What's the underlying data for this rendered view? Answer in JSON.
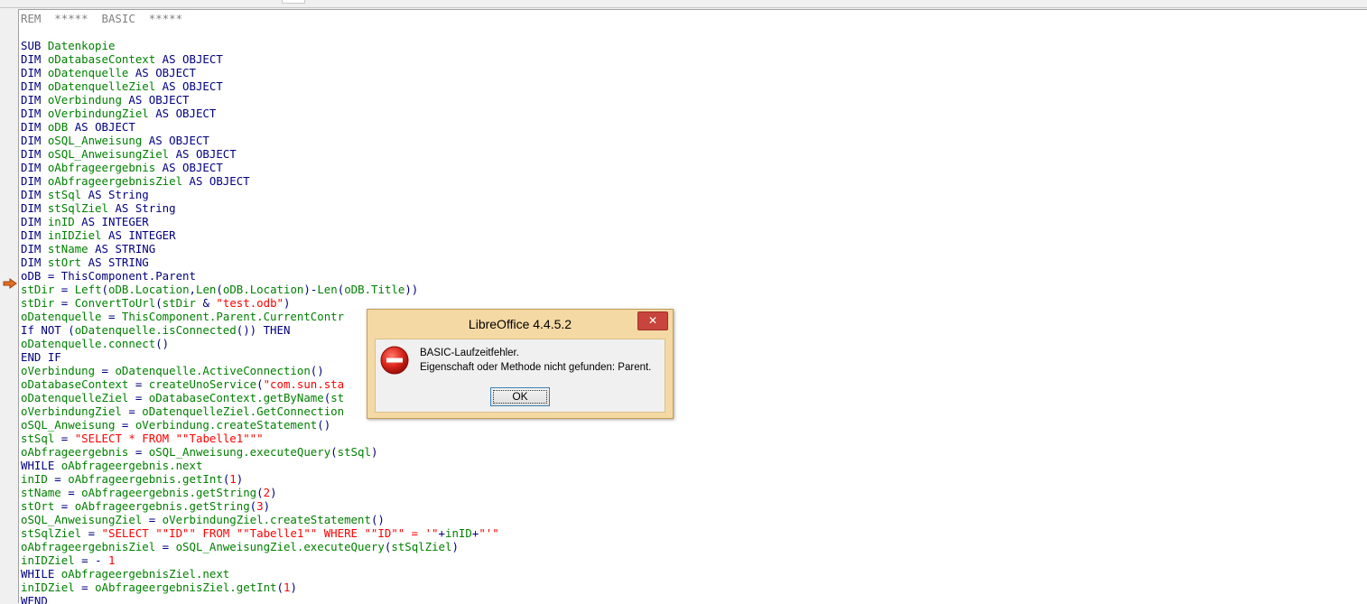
{
  "editor": {
    "lines": [
      [
        {
          "t": "REM  *****  BASIC  *****",
          "c": "com"
        }
      ],
      [
        {
          "t": "",
          "c": "kw"
        }
      ],
      [
        {
          "t": "SUB ",
          "c": "kw"
        },
        {
          "t": "Datenkopie",
          "c": "id"
        }
      ],
      [
        {
          "t": "DIM ",
          "c": "kw"
        },
        {
          "t": "oDatabaseContext",
          "c": "id"
        },
        {
          "t": " AS OBJECT",
          "c": "kw"
        }
      ],
      [
        {
          "t": "DIM ",
          "c": "kw"
        },
        {
          "t": "oDatenquelle",
          "c": "id"
        },
        {
          "t": " AS OBJECT",
          "c": "kw"
        }
      ],
      [
        {
          "t": "DIM ",
          "c": "kw"
        },
        {
          "t": "oDatenquelleZiel",
          "c": "id"
        },
        {
          "t": " AS OBJECT",
          "c": "kw"
        }
      ],
      [
        {
          "t": "DIM ",
          "c": "kw"
        },
        {
          "t": "oVerbindung",
          "c": "id"
        },
        {
          "t": " AS OBJECT",
          "c": "kw"
        }
      ],
      [
        {
          "t": "DIM ",
          "c": "kw"
        },
        {
          "t": "oVerbindungZiel",
          "c": "id"
        },
        {
          "t": " AS OBJECT",
          "c": "kw"
        }
      ],
      [
        {
          "t": "DIM ",
          "c": "kw"
        },
        {
          "t": "oDB",
          "c": "id"
        },
        {
          "t": " AS OBJECT",
          "c": "kw"
        }
      ],
      [
        {
          "t": "DIM ",
          "c": "kw"
        },
        {
          "t": "oSQL_Anweisung",
          "c": "id"
        },
        {
          "t": " AS OBJECT",
          "c": "kw"
        }
      ],
      [
        {
          "t": "DIM ",
          "c": "kw"
        },
        {
          "t": "oSQL_AnweisungZiel",
          "c": "id"
        },
        {
          "t": " AS OBJECT",
          "c": "kw"
        }
      ],
      [
        {
          "t": "DIM ",
          "c": "kw"
        },
        {
          "t": "oAbfrageergebnis",
          "c": "id"
        },
        {
          "t": " AS OBJECT",
          "c": "kw"
        }
      ],
      [
        {
          "t": "DIM ",
          "c": "kw"
        },
        {
          "t": "oAbfrageergebnisZiel",
          "c": "id"
        },
        {
          "t": " AS OBJECT",
          "c": "kw"
        }
      ],
      [
        {
          "t": "DIM ",
          "c": "kw"
        },
        {
          "t": "stSql",
          "c": "id"
        },
        {
          "t": " AS String",
          "c": "kw"
        }
      ],
      [
        {
          "t": "DIM ",
          "c": "kw"
        },
        {
          "t": "stSqlZiel",
          "c": "id"
        },
        {
          "t": " AS String",
          "c": "kw"
        }
      ],
      [
        {
          "t": "DIM ",
          "c": "kw"
        },
        {
          "t": "inID",
          "c": "id"
        },
        {
          "t": " AS INTEGER",
          "c": "kw"
        }
      ],
      [
        {
          "t": "DIM ",
          "c": "kw"
        },
        {
          "t": "inIDZiel",
          "c": "id"
        },
        {
          "t": " AS INTEGER",
          "c": "kw"
        }
      ],
      [
        {
          "t": "DIM ",
          "c": "kw"
        },
        {
          "t": "stName",
          "c": "id"
        },
        {
          "t": " AS STRING",
          "c": "kw"
        }
      ],
      [
        {
          "t": "DIM ",
          "c": "kw"
        },
        {
          "t": "stOrt",
          "c": "id"
        },
        {
          "t": " AS STRING",
          "c": "kw"
        }
      ],
      [
        {
          "t": "oDB = ThisComponent.Parent",
          "c": "hl"
        }
      ],
      [
        {
          "t": "stDir",
          "c": "id"
        },
        {
          "t": " = ",
          "c": "kw"
        },
        {
          "t": "Left",
          "c": "id"
        },
        {
          "t": "(",
          "c": "kw"
        },
        {
          "t": "oDB.Location",
          "c": "id"
        },
        {
          "t": ",",
          "c": "kw"
        },
        {
          "t": "Len",
          "c": "id"
        },
        {
          "t": "(",
          "c": "kw"
        },
        {
          "t": "oDB.Location",
          "c": "id"
        },
        {
          "t": ")-",
          "c": "kw"
        },
        {
          "t": "Len",
          "c": "id"
        },
        {
          "t": "(",
          "c": "kw"
        },
        {
          "t": "oDB.Title",
          "c": "id"
        },
        {
          "t": "))",
          "c": "kw"
        }
      ],
      [
        {
          "t": "stDir",
          "c": "id"
        },
        {
          "t": " = ",
          "c": "kw"
        },
        {
          "t": "ConvertToUrl",
          "c": "id"
        },
        {
          "t": "(",
          "c": "kw"
        },
        {
          "t": "stDir",
          "c": "id"
        },
        {
          "t": " & ",
          "c": "kw"
        },
        {
          "t": "\"test.odb\"",
          "c": "str"
        },
        {
          "t": ")",
          "c": "kw"
        }
      ],
      [
        {
          "t": "oDatenquelle",
          "c": "id"
        },
        {
          "t": " = ",
          "c": "kw"
        },
        {
          "t": "ThisComponent.Parent.CurrentContr",
          "c": "id"
        }
      ],
      [
        {
          "t": "If NOT (",
          "c": "kw"
        },
        {
          "t": "oDatenquelle.isConnected",
          "c": "id"
        },
        {
          "t": "()) THEN",
          "c": "kw"
        }
      ],
      [
        {
          "t": "oDatenquelle.connect",
          "c": "id"
        },
        {
          "t": "()",
          "c": "kw"
        }
      ],
      [
        {
          "t": "END IF",
          "c": "kw"
        }
      ],
      [
        {
          "t": "oVerbindung",
          "c": "id"
        },
        {
          "t": " = ",
          "c": "kw"
        },
        {
          "t": "oDatenquelle.ActiveConnection",
          "c": "id"
        },
        {
          "t": "()",
          "c": "kw"
        }
      ],
      [
        {
          "t": "oDatabaseContext",
          "c": "id"
        },
        {
          "t": " = ",
          "c": "kw"
        },
        {
          "t": "createUnoService",
          "c": "id"
        },
        {
          "t": "(",
          "c": "kw"
        },
        {
          "t": "\"com.sun.sta",
          "c": "str"
        }
      ],
      [
        {
          "t": "oDatenquelleZiel",
          "c": "id"
        },
        {
          "t": " = ",
          "c": "kw"
        },
        {
          "t": "oDatabaseContext.getByName",
          "c": "id"
        },
        {
          "t": "(",
          "c": "kw"
        },
        {
          "t": "st",
          "c": "id"
        }
      ],
      [
        {
          "t": "oVerbindungZiel",
          "c": "id"
        },
        {
          "t": " = ",
          "c": "kw"
        },
        {
          "t": "oDatenquelleZiel.GetConnection",
          "c": "id"
        }
      ],
      [
        {
          "t": "oSQL_Anweisung",
          "c": "id"
        },
        {
          "t": " = ",
          "c": "kw"
        },
        {
          "t": "oVerbindung.createStatement",
          "c": "id"
        },
        {
          "t": "()",
          "c": "kw"
        }
      ],
      [
        {
          "t": "stSql",
          "c": "id"
        },
        {
          "t": " = ",
          "c": "kw"
        },
        {
          "t": "\"SELECT * FROM \"\"Tabelle1\"\"\"",
          "c": "str"
        }
      ],
      [
        {
          "t": "oAbfrageergebnis",
          "c": "id"
        },
        {
          "t": " = ",
          "c": "kw"
        },
        {
          "t": "oSQL_Anweisung.executeQuery",
          "c": "id"
        },
        {
          "t": "(",
          "c": "kw"
        },
        {
          "t": "stSql",
          "c": "id"
        },
        {
          "t": ")",
          "c": "kw"
        }
      ],
      [
        {
          "t": "WHILE ",
          "c": "kw"
        },
        {
          "t": "oAbfrageergebnis.next",
          "c": "id"
        }
      ],
      [
        {
          "t": "inID",
          "c": "id"
        },
        {
          "t": " = ",
          "c": "kw"
        },
        {
          "t": "oAbfrageergebnis.getInt",
          "c": "id"
        },
        {
          "t": "(",
          "c": "kw"
        },
        {
          "t": "1",
          "c": "num"
        },
        {
          "t": ")",
          "c": "kw"
        }
      ],
      [
        {
          "t": "stName",
          "c": "id"
        },
        {
          "t": " = ",
          "c": "kw"
        },
        {
          "t": "oAbfrageergebnis.getString",
          "c": "id"
        },
        {
          "t": "(",
          "c": "kw"
        },
        {
          "t": "2",
          "c": "num"
        },
        {
          "t": ")",
          "c": "kw"
        }
      ],
      [
        {
          "t": "stOrt",
          "c": "id"
        },
        {
          "t": " = ",
          "c": "kw"
        },
        {
          "t": "oAbfrageergebnis.getString",
          "c": "id"
        },
        {
          "t": "(",
          "c": "kw"
        },
        {
          "t": "3",
          "c": "num"
        },
        {
          "t": ")",
          "c": "kw"
        }
      ],
      [
        {
          "t": "oSQL_AnweisungZiel",
          "c": "id"
        },
        {
          "t": " = ",
          "c": "kw"
        },
        {
          "t": "oVerbindungZiel.createStatement",
          "c": "id"
        },
        {
          "t": "()",
          "c": "kw"
        }
      ],
      [
        {
          "t": "stSqlZiel",
          "c": "id"
        },
        {
          "t": " = ",
          "c": "kw"
        },
        {
          "t": "\"SELECT \"\"ID\"\" FROM \"\"Tabelle1\"\" WHERE \"\"ID\"\" = '\"",
          "c": "str"
        },
        {
          "t": "+",
          "c": "kw"
        },
        {
          "t": "inID",
          "c": "id"
        },
        {
          "t": "+",
          "c": "kw"
        },
        {
          "t": "\"'\"",
          "c": "str"
        }
      ],
      [
        {
          "t": "oAbfrageergebnisZiel",
          "c": "id"
        },
        {
          "t": " = ",
          "c": "kw"
        },
        {
          "t": "oSQL_AnweisungZiel.executeQuery",
          "c": "id"
        },
        {
          "t": "(",
          "c": "kw"
        },
        {
          "t": "stSqlZiel",
          "c": "id"
        },
        {
          "t": ")",
          "c": "kw"
        }
      ],
      [
        {
          "t": "inIDZiel",
          "c": "id"
        },
        {
          "t": " = - ",
          "c": "kw"
        },
        {
          "t": "1",
          "c": "num"
        }
      ],
      [
        {
          "t": "WHILE ",
          "c": "kw"
        },
        {
          "t": "oAbfrageergebnisZiel.next",
          "c": "id"
        }
      ],
      [
        {
          "t": "inIDZiel",
          "c": "id"
        },
        {
          "t": " = ",
          "c": "kw"
        },
        {
          "t": "oAbfrageergebnisZiel.getInt",
          "c": "id"
        },
        {
          "t": "(",
          "c": "kw"
        },
        {
          "t": "1",
          "c": "num"
        },
        {
          "t": ")",
          "c": "kw"
        }
      ],
      [
        {
          "t": "WEND",
          "c": "kw"
        }
      ]
    ]
  },
  "breakpoint": {
    "icon": "current-line-arrow-icon",
    "color": "#e07020"
  },
  "dialog": {
    "title": "LibreOffice 4.4.5.2",
    "close_label": "✕",
    "error_icon": "error-stop-icon",
    "message_line1": "BASIC-Laufzeitfehler.",
    "message_line2": "Eigenschaft oder Methode nicht gefunden: Parent.",
    "ok_label": "OK"
  },
  "colors": {
    "keyword": "#000080",
    "identifier": "#008000",
    "string": "#ff0000",
    "comment": "#808080",
    "selection": "#3390ff",
    "dialog_frame": "#f5d9a5",
    "close_button": "#c7453d"
  }
}
